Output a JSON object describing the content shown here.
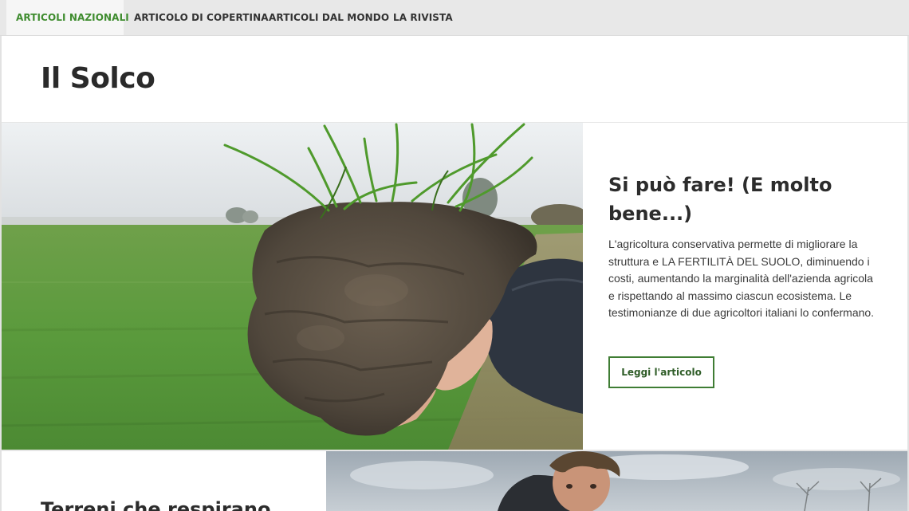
{
  "nav": {
    "tabs": [
      {
        "label": "ARTICOLI NAZIONALI",
        "active": true
      },
      {
        "label": "ARTICOLO DI COPERTINA",
        "active": false
      },
      {
        "label": "ARTICOLI DAL MONDO",
        "active": false
      },
      {
        "label": "LA RIVISTA",
        "active": false
      }
    ]
  },
  "site": {
    "title": "Il Solco"
  },
  "featured": {
    "image": "photo-hands-holding-soil-clod-with-wheat-seedlings",
    "title": "Si può fare! (E molto bene...)",
    "excerpt": "L'agricoltura conservativa permette di migliorare la struttura e LA FERTILITÀ DEL SUOLO, diminuendo i costi, aumentando la marginalità dell'azienda agricola e rispettando al massimo ciascun ecosistema. Le testimonianze di due agricoltori italiani lo confermano.",
    "button_label": "Leggi l'articolo"
  },
  "second_article": {
    "title": "Terreni che respirano",
    "image": "photo-farmer-in-field"
  },
  "colors": {
    "accent": "#3f8c2f",
    "button_border": "#3f7d34",
    "nav_background": "#e8e8e8"
  }
}
